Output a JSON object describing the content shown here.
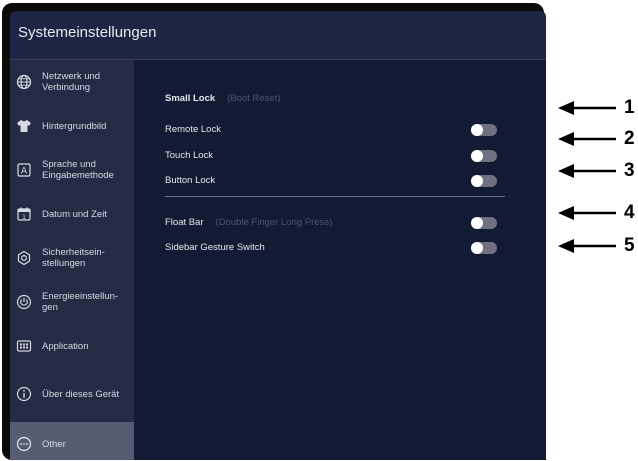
{
  "window": {
    "title": "Systemeinstellungen"
  },
  "sidebar": {
    "items": [
      {
        "label": "Netzwerk und\nVerbindung",
        "icon": "globe-icon",
        "active": false
      },
      {
        "label": "Hintergrundbild",
        "icon": "shirt-icon",
        "active": false
      },
      {
        "label": "Sprache und\nEingabemethode",
        "icon": "keyboard-a-icon",
        "active": false
      },
      {
        "label": "Datum und Zeit",
        "icon": "calendar-icon",
        "active": false
      },
      {
        "label": "Sicherheitsein-\nstellungen",
        "icon": "security-icon",
        "active": false
      },
      {
        "label": "Energieeinstellun-\ngen",
        "icon": "power-icon",
        "active": false
      },
      {
        "label": "Application",
        "icon": "apps-grid-icon",
        "active": false
      },
      {
        "label": "Über dieses Gerät",
        "icon": "info-icon",
        "active": false
      },
      {
        "label": "Other",
        "icon": "more-icon",
        "active": true
      }
    ]
  },
  "main": {
    "section_title": "Small Lock",
    "section_hint": "(Boot Reset)",
    "settings": [
      {
        "label": "Remote Lock",
        "hint": "",
        "enabled": false
      },
      {
        "label": "Touch Lock",
        "hint": "",
        "enabled": false
      },
      {
        "label": "Button Lock",
        "hint": "",
        "enabled": false
      },
      {
        "label": "Float Bar",
        "hint": "(Double Finger Long Press)",
        "enabled": false
      },
      {
        "label": "Sidebar Gesture Switch",
        "hint": "",
        "enabled": false
      }
    ]
  },
  "callouts": [
    "1",
    "2",
    "3",
    "4",
    "5"
  ],
  "colors": {
    "title_bar": "#1d2542",
    "sidebar": "#262b45",
    "sidebar_active": "#575c73",
    "content": "#131a33",
    "toggle_off": "#6d7182"
  }
}
